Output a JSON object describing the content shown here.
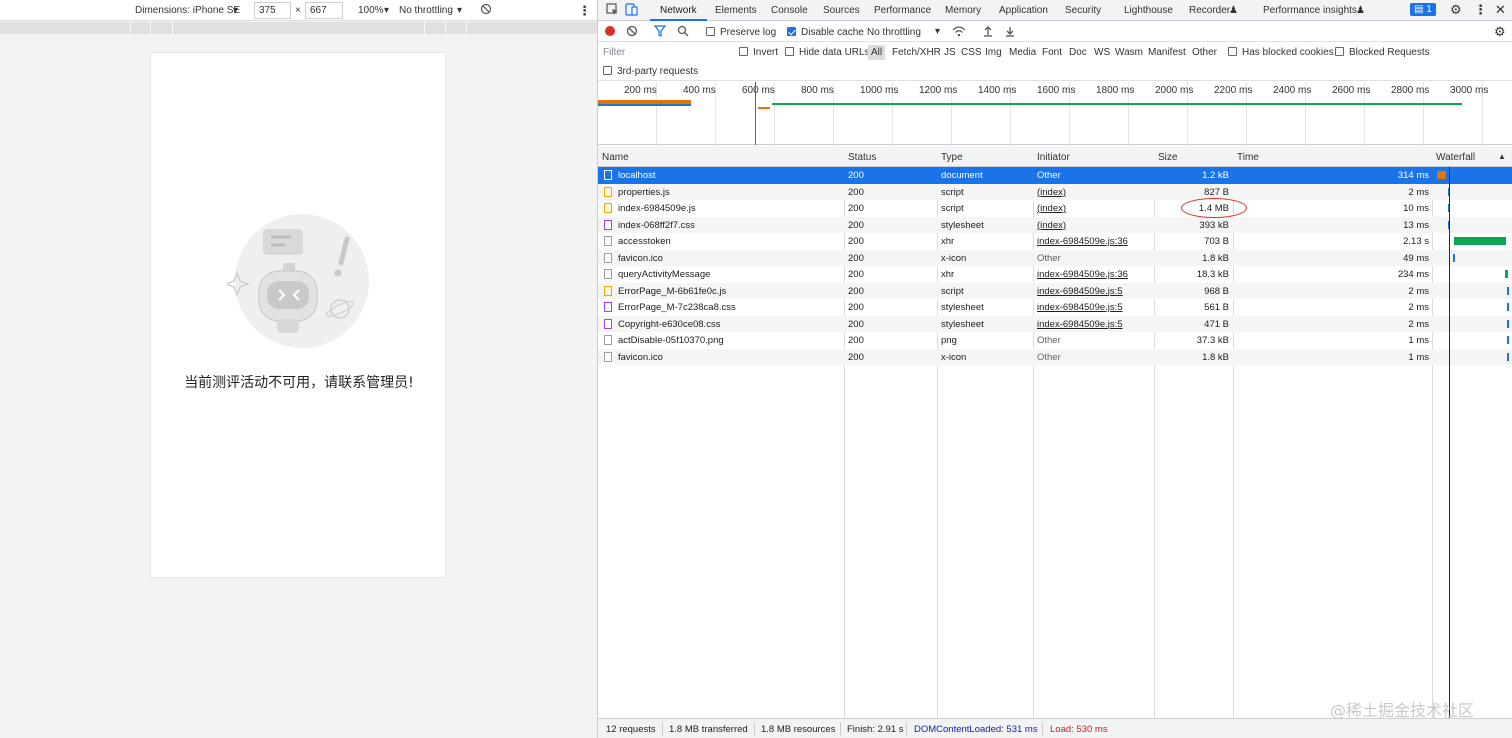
{
  "device_toolbar": {
    "dimensions_label": "Dimensions: iPhone SE",
    "width": "375",
    "times": "×",
    "height": "667",
    "zoom": "100%",
    "throttling": "No throttling"
  },
  "phone": {
    "message": "当前测评活动不可用，请联系管理员!"
  },
  "devtools": {
    "tabs": [
      "Network",
      "Elements",
      "Console",
      "Sources",
      "Performance",
      "Memory",
      "Application",
      "Security",
      "Lighthouse",
      "Recorder",
      "Performance insights"
    ],
    "issues_count": "1",
    "toolbar": {
      "preserve_log": "Preserve log",
      "disable_cache": "Disable cache",
      "throttling": "No throttling"
    },
    "filter": {
      "placeholder": "Filter",
      "invert": "Invert",
      "hide_data_urls": "Hide data URLs",
      "types": [
        "All",
        "Fetch/XHR",
        "JS",
        "CSS",
        "Img",
        "Media",
        "Font",
        "Doc",
        "WS",
        "Wasm",
        "Manifest",
        "Other"
      ],
      "has_blocked_cookies": "Has blocked cookies",
      "blocked_requests": "Blocked Requests",
      "third_party": "3rd-party requests"
    },
    "overview_ticks": [
      "200 ms",
      "400 ms",
      "600 ms",
      "800 ms",
      "1000 ms",
      "1200 ms",
      "1400 ms",
      "1600 ms",
      "1800 ms",
      "2000 ms",
      "2200 ms",
      "2400 ms",
      "2600 ms",
      "2800 ms",
      "3000 ms"
    ],
    "columns": {
      "name": "Name",
      "status": "Status",
      "type": "Type",
      "initiator": "Initiator",
      "size": "Size",
      "time": "Time",
      "waterfall": "Waterfall"
    },
    "rows": [
      {
        "name": "localhost",
        "status": "200",
        "type": "document",
        "initiator": "Other",
        "size": "1.2 kB",
        "time": "314 ms",
        "icon": "doc",
        "wf_start": 0.01,
        "wf_len": 0.13,
        "wf_color": "#e37400",
        "link": false
      },
      {
        "name": "properties.js",
        "status": "200",
        "type": "script",
        "initiator": "(index)",
        "size": "827 B",
        "time": "2 ms",
        "icon": "script",
        "wf_start": 0.17,
        "wf_len": 0.02,
        "wf_color": "#1a73e8",
        "link": true
      },
      {
        "name": "index-6984509e.js",
        "status": "200",
        "type": "script",
        "initiator": "(index)",
        "size": "1.4 MB",
        "time": "10 ms",
        "icon": "script",
        "wf_start": 0.16,
        "wf_len": 0.02,
        "wf_color": "#1a73e8",
        "link": true
      },
      {
        "name": "index-068ff2f7.css",
        "status": "200",
        "type": "stylesheet",
        "initiator": "(index)",
        "size": "393 kB",
        "time": "13 ms",
        "icon": "css",
        "wf_start": 0.17,
        "wf_len": 0.02,
        "wf_color": "#1a73e8",
        "link": true
      },
      {
        "name": "accesstoken",
        "status": "200",
        "type": "xhr",
        "initiator": "index-6984509e.js:36",
        "size": "703 B",
        "time": "2.13 s",
        "icon": "plain",
        "wf_start": 0.25,
        "wf_len": 0.72,
        "wf_color": "#0ca750",
        "link": true
      },
      {
        "name": "favicon.ico",
        "status": "200",
        "type": "x-icon",
        "initiator": "Other",
        "size": "1.8 kB",
        "time": "49 ms",
        "icon": "plain",
        "wf_start": 0.24,
        "wf_len": 0.02,
        "wf_color": "#1a73e8",
        "link": false
      },
      {
        "name": "queryActivityMessage",
        "status": "200",
        "type": "xhr",
        "initiator": "index-6984509e.js:36",
        "size": "18.3 kB",
        "time": "234 ms",
        "icon": "plain",
        "wf_start": 0.96,
        "wf_len": 0.04,
        "wf_color": "#0ca750",
        "link": true
      },
      {
        "name": "ErrorPage_M-6b61fe0c.js",
        "status": "200",
        "type": "script",
        "initiator": "index-6984509e.js:5",
        "size": "968 B",
        "time": "2 ms",
        "icon": "script",
        "wf_start": 0.99,
        "wf_len": 0.01,
        "wf_color": "#1a73e8",
        "link": true
      },
      {
        "name": "ErrorPage_M-7c238ca8.css",
        "status": "200",
        "type": "stylesheet",
        "initiator": "index-6984509e.js:5",
        "size": "561 B",
        "time": "2 ms",
        "icon": "css",
        "wf_start": 0.99,
        "wf_len": 0.01,
        "wf_color": "#1a73e8",
        "link": true
      },
      {
        "name": "Copyright-e630ce08.css",
        "status": "200",
        "type": "stylesheet",
        "initiator": "index-6984509e.js:5",
        "size": "471 B",
        "time": "2 ms",
        "icon": "css",
        "wf_start": 0.99,
        "wf_len": 0.01,
        "wf_color": "#1a73e8",
        "link": true
      },
      {
        "name": "actDisable-05f10370.png",
        "status": "200",
        "type": "png",
        "initiator": "Other",
        "size": "37.3 kB",
        "time": "1 ms",
        "icon": "plain",
        "wf_start": 0.99,
        "wf_len": 0.01,
        "wf_color": "#1a73e8",
        "link": false
      },
      {
        "name": "favicon.ico",
        "status": "200",
        "type": "x-icon",
        "initiator": "Other",
        "size": "1.8 kB",
        "time": "1 ms",
        "icon": "plain",
        "wf_start": 0.99,
        "wf_len": 0.01,
        "wf_color": "#1a73e8",
        "link": false
      }
    ],
    "status_bar": {
      "requests": "12 requests",
      "transferred": "1.8 MB transferred",
      "resources": "1.8 MB resources",
      "finish": "Finish: 2.91 s",
      "dom_loaded": "DOMContentLoaded: 531 ms",
      "load": "Load: 530 ms"
    },
    "colors": {
      "accent": "#1a73e8",
      "dom_loaded": "#1a1aa6",
      "load": "#c5221f",
      "annotation": "#d93025"
    }
  },
  "watermark": "@稀土掘金技术社区"
}
